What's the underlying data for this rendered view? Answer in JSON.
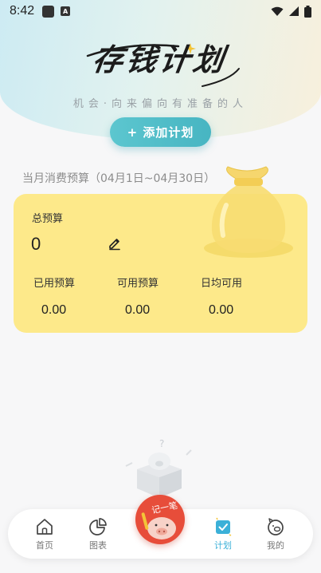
{
  "status_bar": {
    "time": "8:42"
  },
  "header": {
    "logo_text": "存钱计划",
    "slogan": "机会·向来偏向有准备的人",
    "add_button": "+ 添加计划"
  },
  "budget": {
    "caption": "当月消费预算（04月1日~04月30日）",
    "total_label": "总预算",
    "total_value": "0",
    "stats": [
      {
        "label": "已用预算",
        "value": "0.00"
      },
      {
        "label": "可用预算",
        "value": "0.00"
      },
      {
        "label": "日均可用",
        "value": "0.00"
      }
    ]
  },
  "tabbar": {
    "items": [
      {
        "label": "首页",
        "icon": "home-icon"
      },
      {
        "label": "图表",
        "icon": "pie-chart-icon"
      },
      {
        "label": "计划",
        "icon": "plan-check-icon",
        "active": true
      },
      {
        "label": "我的",
        "icon": "pig-face-icon"
      }
    ],
    "fab_label": "记一笔"
  },
  "colors": {
    "accent": "#4dbcc8",
    "card": "#fde98a",
    "active_tab": "#3bb0d8",
    "fab": "#e74d3a"
  }
}
